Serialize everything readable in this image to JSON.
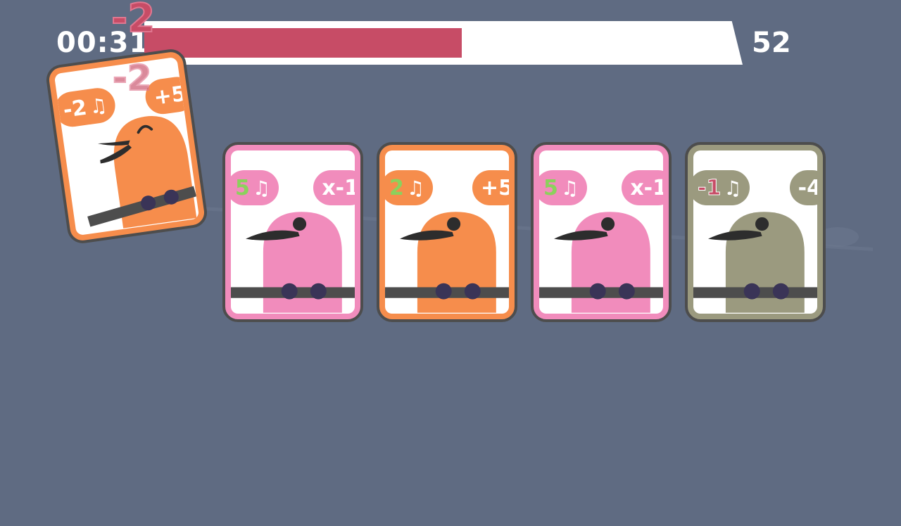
{
  "hud": {
    "timer": "00:31",
    "score": "52",
    "progress": 0.53,
    "popup_top": "-2",
    "popup_faded": "-2"
  },
  "colors": {
    "background": "#5f6b82",
    "progress_fill": "#c74c66",
    "pink": "#f18cbc",
    "orange": "#f68d4c",
    "gray": "#9b9a7f"
  },
  "cards": {
    "held": {
      "song": "-2",
      "effect": "+5",
      "note_icon": "music-note-icon",
      "color": "#f68d4c",
      "bird": "singing"
    },
    "items": [
      {
        "song": "5",
        "effect": "x-1",
        "note_icon": "music-note-icon",
        "color": "#f18cbc"
      },
      {
        "song": "2",
        "effect": "+5",
        "note_icon": "music-note-icon",
        "color": "#f68d4c"
      },
      {
        "song": "5",
        "effect": "x-1",
        "note_icon": "music-note-icon",
        "color": "#f18cbc"
      },
      {
        "song": "-1",
        "effect": "-4",
        "note_icon": "music-note-icon",
        "color": "#9b9a7f"
      }
    ]
  }
}
